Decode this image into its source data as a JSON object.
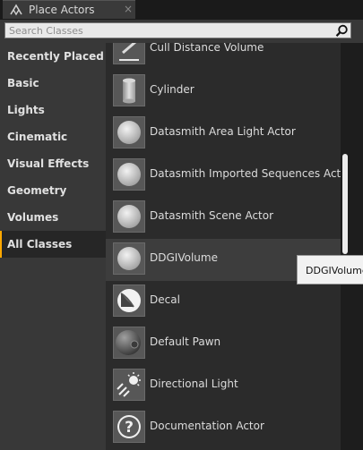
{
  "tab": {
    "title": "Place Actors",
    "icon": "place-actors-icon",
    "close_label": "×"
  },
  "search": {
    "placeholder": "Search Classes",
    "value": "",
    "icon": "search-icon"
  },
  "sidebar": {
    "items": [
      {
        "label": "Recently Placed",
        "active": false
      },
      {
        "label": "Basic",
        "active": false
      },
      {
        "label": "Lights",
        "active": false
      },
      {
        "label": "Cinematic",
        "active": false
      },
      {
        "label": "Visual Effects",
        "active": false
      },
      {
        "label": "Geometry",
        "active": false
      },
      {
        "label": "Volumes",
        "active": false
      },
      {
        "label": "All Classes",
        "active": true
      }
    ]
  },
  "actors": [
    {
      "label": "Cull Distance Volume",
      "icon": "volume-icon"
    },
    {
      "label": "Cylinder",
      "icon": "cylinder-icon"
    },
    {
      "label": "Datasmith Area Light Actor",
      "icon": "sphere-icon"
    },
    {
      "label": "Datasmith Imported Sequences Actor",
      "icon": "sphere-icon"
    },
    {
      "label": "Datasmith Scene Actor",
      "icon": "sphere-icon"
    },
    {
      "label": "DDGIVolume",
      "icon": "sphere-icon",
      "hover": true
    },
    {
      "label": "Decal",
      "icon": "decal-icon"
    },
    {
      "label": "Default Pawn",
      "icon": "pawn-icon"
    },
    {
      "label": "Directional Light",
      "icon": "directional-light-icon"
    },
    {
      "label": "Documentation Actor",
      "icon": "documentation-icon"
    }
  ],
  "tooltip": {
    "text": "DDGIVolume"
  },
  "colors": {
    "accent": "#ffa800",
    "panel": "#383838",
    "list_bg": "#2b2b2b",
    "hover_row": "#3d3d3d"
  }
}
